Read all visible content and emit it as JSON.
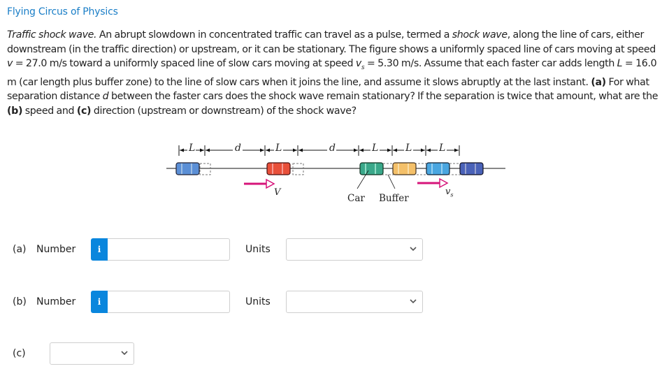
{
  "header": {
    "source": "Flying Circus of Physics"
  },
  "problem": {
    "title_italic": "Traffic shock wave.",
    "p1": " An abrupt slowdown in concentrated traffic can travel as a pulse, termed a ",
    "shock_italic": "shock wave",
    "p2": ", along the line of cars, either downstream (in the traffic direction) or upstream, or it can be stationary. The figure shows a uniformly spaced line of cars moving at speed ",
    "v_sym": "v",
    "p3": " = 27.0 m/s toward a uniformly spaced line of slow cars moving at speed ",
    "vs_sym": "v",
    "vs_sub": "s",
    "p4": " = 5.30 m/s. Assume that each faster car adds length ",
    "L_sym": "L",
    "p5": " = 16.0 m (car length plus buffer zone) to the line of slow cars when it joins the line, and assume it slows abruptly at the last instant. ",
    "a_tag": "(a)",
    "p6": " For what separation distance ",
    "d_sym": "d",
    "p7": " between the faster cars does the shock wave remain stationary? If the separation is twice that amount, what are the ",
    "b_tag": "(b)",
    "p8": " speed and ",
    "c_tag": "(c)",
    "p9": " direction (upstream or downstream) of the shock wave?"
  },
  "figure": {
    "labels": {
      "L": "L",
      "d": "d",
      "V": "V",
      "vs": "v",
      "vs_sub": "s",
      "car": "Car",
      "buffer": "Buffer"
    },
    "colors": {
      "blue_car": "#5b8fd6",
      "red_car": "#e8503a",
      "green_car": "#3aa88a",
      "yellow_car": "#f4c069",
      "lightblue_car": "#4aa6e0",
      "navy_car": "#4a62b8",
      "arrow": "#d6147a"
    }
  },
  "answers": {
    "a": {
      "tag": "(a)",
      "number_label": "Number",
      "info_icon": "i",
      "value": "",
      "units_label": "Units",
      "units_value": ""
    },
    "b": {
      "tag": "(b)",
      "number_label": "Number",
      "info_icon": "i",
      "value": "",
      "units_label": "Units",
      "units_value": ""
    },
    "c": {
      "tag": "(c)",
      "value": ""
    }
  }
}
